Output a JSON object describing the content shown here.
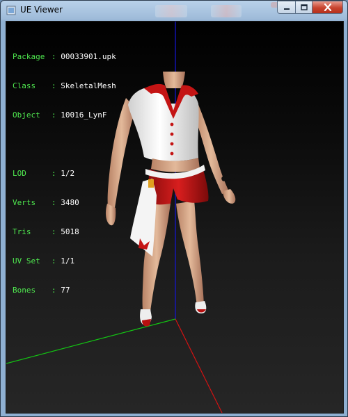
{
  "window": {
    "title": "UE Viewer",
    "icons": [
      "app-icon",
      "minimize-icon",
      "maximize-icon",
      "close-icon"
    ]
  },
  "info": {
    "package": {
      "label": "Package",
      "value": "00033901.upk"
    },
    "class": {
      "label": "Class  ",
      "value": "SkeletalMesh"
    },
    "object": {
      "label": "Object ",
      "value": "10016_LynF"
    },
    "lod": {
      "label": "LOD    ",
      "value": "1/2"
    },
    "verts": {
      "label": "Verts  ",
      "value": "3480"
    },
    "tris": {
      "label": "Tris   ",
      "value": "5018"
    },
    "uvset": {
      "label": "UV Set ",
      "value": "1/1"
    },
    "bones": {
      "label": "Bones  ",
      "value": "77"
    },
    "separator": ":"
  },
  "colors": {
    "label_green": "#4fe84f",
    "axis_x": "#d01010",
    "axis_y": "#10c010",
    "axis_z": "#1010d0"
  }
}
